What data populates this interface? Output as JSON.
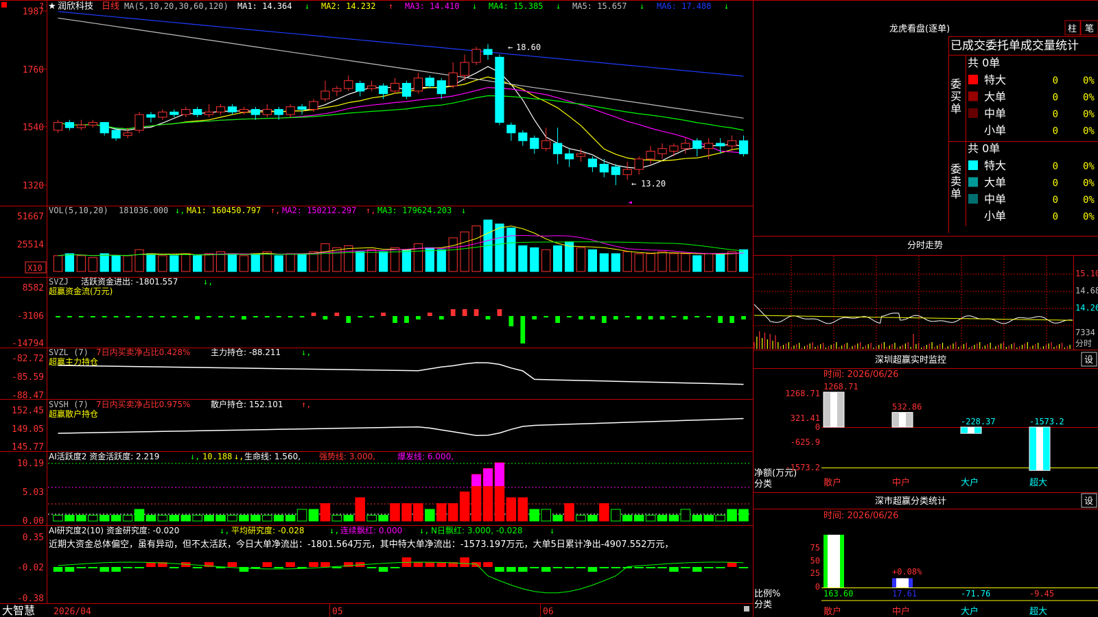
{
  "colors": {
    "up": "#ff3232",
    "down": "#00ffff",
    "grid": "#c00000",
    "bg": "#000000",
    "ma1": "#ffffff",
    "ma2": "#ffff00",
    "ma3": "#ff00ff",
    "ma4": "#00ff00",
    "ma5": "#c0c0c0",
    "ma6": "#1e3cff"
  },
  "header": {
    "star": "★",
    "stock_name": "润欣科技",
    "period": "日线",
    "ma_params": "MA(5,10,20,30,60,120)",
    "ma": [
      {
        "label": "MA1: 14.364",
        "arrow": "↓"
      },
      {
        "label": "MA2: 14.232",
        "arrow": "↑"
      },
      {
        "label": "MA3: 14.410",
        "arrow": "↓"
      },
      {
        "label": "MA4: 15.385",
        "arrow": "↓"
      },
      {
        "label": "MA5: 15.657",
        "arrow": "↓"
      },
      {
        "label": "MA6: 17.488",
        "arrow": "↓"
      }
    ]
  },
  "price_axis": [
    "1987",
    "1760",
    "1540",
    "1320"
  ],
  "price_annotations": {
    "high": "18.60",
    "low": "13.20"
  },
  "vol": {
    "params": "VOL(5,10,20)",
    "value": "181036.000",
    "ma1": "MA1: 160450.797",
    "ma2": "MA2: 150212.297",
    "ma3": "MA3: 179624.203",
    "axis": [
      "51667",
      "25514"
    ],
    "unit": "X10"
  },
  "svzj": {
    "name": "SVZJ",
    "label": "活跃资金进出: -1801.557",
    "sub": "超赢资金流(万元)",
    "axis": [
      "8582",
      "-3106",
      "-14794"
    ]
  },
  "svzl": {
    "name": "SVZL (7)",
    "label1": "7日内买卖净占比0.428%",
    "label2": "主力持仓: -88.211",
    "sub": "超赢主力持仓",
    "axis": [
      "-82.72",
      "-85.59",
      "-88.47"
    ]
  },
  "svsh": {
    "name": "SVSH (7)",
    "label1": "7日内买卖净占比0.975%",
    "label2": "散户持仓: 152.101",
    "sub": "超赢散户持仓",
    "axis": [
      "152.45",
      "149.05",
      "145.77"
    ]
  },
  "ai1": {
    "label": "AI活跃度2 资金活跃度: 2.219",
    "v2": "10.188",
    "v3": "生命线: 1.560,",
    "v4": "强势线: 3.000,",
    "v5": "爆发线: 6.000,",
    "axis": [
      "10.19",
      "5.03",
      "0.00"
    ]
  },
  "ai2": {
    "label": "AI研究度2(10) 资金研究度: -0.020",
    "v2": "平均研究度: -0.028",
    "v3": "连续飘红: 0.000",
    "v4": "N日飘红: 3.000, -0.028",
    "axis": [
      "0.35",
      "-0.02",
      "-0.38"
    ],
    "comment": "近期大资金总体偏空，虽有异动，但不太活跃，今日大单净流出：-1801.564万元，其中特大单净流出：-1573.197万元，大单5日累计净出-4907.552万元，"
  },
  "footer": {
    "brand": "大智慧",
    "dates": [
      "2026/04",
      "05",
      "06"
    ]
  },
  "right": {
    "lhb_title": "龙虎看盘(逐单)",
    "btn_zhu": "柱",
    "btn_bi": "笔",
    "table_title": "已成交委托单成交量统计",
    "buy_label": "委买单",
    "sell_label": "委卖单",
    "buy_total": "共 0单",
    "sell_total": "共 0单",
    "buy_rows": [
      {
        "name": "特大",
        "count": "0",
        "pct": "0%",
        "color": "#ff0000"
      },
      {
        "name": "大单",
        "count": "0",
        "pct": "0%",
        "color": "#990000"
      },
      {
        "name": "中单",
        "count": "0",
        "pct": "0%",
        "color": "#660000"
      },
      {
        "name": "小单",
        "count": "0",
        "pct": "0%",
        "color": ""
      }
    ],
    "sell_rows": [
      {
        "name": "特大",
        "count": "0",
        "pct": "0%",
        "color": "#00ffff"
      },
      {
        "name": "大单",
        "count": "0",
        "pct": "0%",
        "color": "#009999"
      },
      {
        "name": "中单",
        "count": "0",
        "pct": "0%",
        "color": "#006f6f"
      },
      {
        "name": "小单",
        "count": "0",
        "pct": "0%",
        "color": ""
      }
    ],
    "fenshi_title": "分时走势",
    "fenshi_axis": [
      "15.10",
      "14.68",
      "14.26",
      "7334",
      "分时"
    ],
    "sz_monitor_title": "深圳超赢实时监控",
    "sz_monitor_time": "时间: 2026/06/26",
    "sz_monitor_axis": [
      "1268.71",
      "321.41",
      "0",
      "-625.9",
      "-1573.2"
    ],
    "sz_monitor_ylabel": [
      "净额(万元)",
      "分类"
    ],
    "sz_monitor_bars": [
      {
        "cat": "散户",
        "value": "1268.71"
      },
      {
        "cat": "中户",
        "value": "532.86"
      },
      {
        "cat": "大户",
        "value": "-228.37"
      },
      {
        "cat": "超大",
        "value": "-1573.2"
      }
    ],
    "set_btn": "设",
    "sz_class_title": "深市超赢分类统计",
    "sz_class_time": "时间: 2026/06/26",
    "sz_class_axis": [
      "75",
      "50",
      "25",
      "0"
    ],
    "sz_class_ylabel": [
      "比例%",
      "分类"
    ],
    "sz_class_bars": [
      {
        "cat": "散户",
        "value": "163.60"
      },
      {
        "cat": "中户",
        "value": "17.61"
      },
      {
        "cat": "大户",
        "value": "-71.76"
      },
      {
        "cat": "超大",
        "value": "-9.45"
      }
    ],
    "sz_class_note": "+0.08%"
  }
}
